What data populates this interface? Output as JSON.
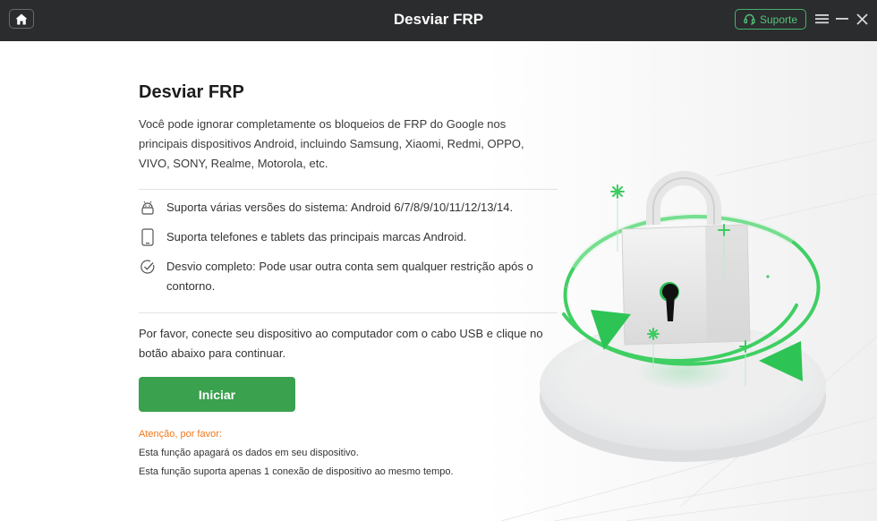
{
  "titlebar": {
    "title": "Desviar FRP",
    "support_label": "Suporte"
  },
  "icons": {
    "home": "home-icon",
    "headset": "headset-icon",
    "menu": "menu-icon",
    "minimize": "minimize-icon",
    "close": "close-icon",
    "android": "android-icon",
    "phone": "phone-icon",
    "check": "check-circle-icon",
    "lock": "lock-illustration"
  },
  "main": {
    "heading": "Desviar FRP",
    "description": "Você pode ignorar completamente os bloqueios de FRP do Google nos principais dispositivos Android, incluindo Samsung, Xiaomi, Redmi, OPPO, VIVO, SONY, Realme, Motorola, etc.",
    "features": [
      "Suporta várias versões do sistema: Android 6/7/8/9/10/11/12/13/14.",
      "Suporta telefones e tablets das principais marcas Android.",
      "Desvio completo: Pode usar outra conta sem qualquer restrição após o contorno."
    ],
    "instruction": "Por favor, conecte seu dispositivo ao computador com o cabo USB e clique no botão abaixo para continuar.",
    "start_label": "Iniciar",
    "warning_title": "Atenção, por favor:",
    "warnings": [
      "Esta função apagará os dados em seu dispositivo.",
      "Esta função suporta apenas 1 conexão de dispositivo ao mesmo tempo."
    ]
  },
  "colors": {
    "titlebar_bg": "#2b2c2e",
    "accent_green": "#3aa14e",
    "support_green": "#52c47a",
    "warning_orange": "#f0771b"
  }
}
